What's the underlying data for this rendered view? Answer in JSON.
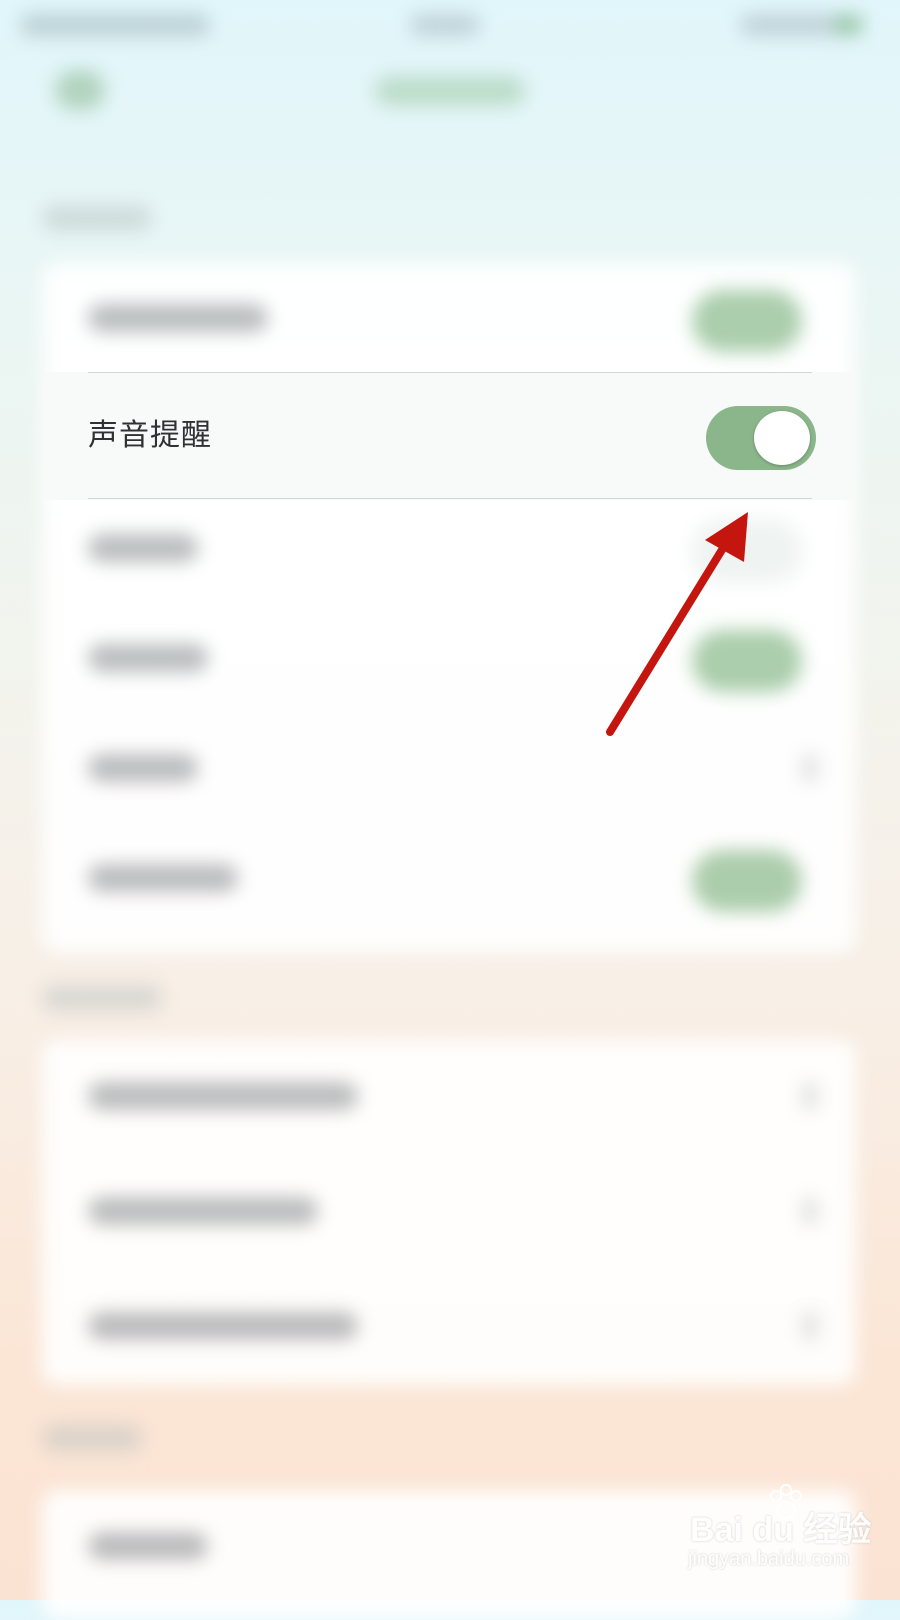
{
  "focused_setting": {
    "label": "声音提醒",
    "enabled": true
  },
  "colors": {
    "toggle_on": "#8bb68b",
    "arrow": "#c4160f",
    "label_text": "#2f3133"
  },
  "watermark": {
    "logo_text": "Bai du 经验",
    "url": "jingyan.baidu.com"
  }
}
